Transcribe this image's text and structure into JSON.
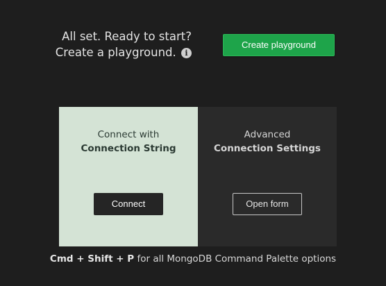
{
  "ready": {
    "line1": "All set. Ready to start?",
    "line2": "Create a playground.",
    "info_icon": "info-icon"
  },
  "create_playground_label": "Create playground",
  "connection_string_panel": {
    "line1": "Connect with",
    "line2": "Connection String",
    "button_label": "Connect"
  },
  "connection_settings_panel": {
    "line1": "Advanced",
    "line2": "Connection Settings",
    "button_label": "Open form"
  },
  "hint": {
    "shortcut": "Cmd + Shift + P",
    "text": "for all MongoDB Command Palette options"
  },
  "colors": {
    "background": "#1e1e1e",
    "accent_green": "#1ea44a",
    "left_panel": "#d4e3d5",
    "right_panel": "#2a2a2a"
  }
}
